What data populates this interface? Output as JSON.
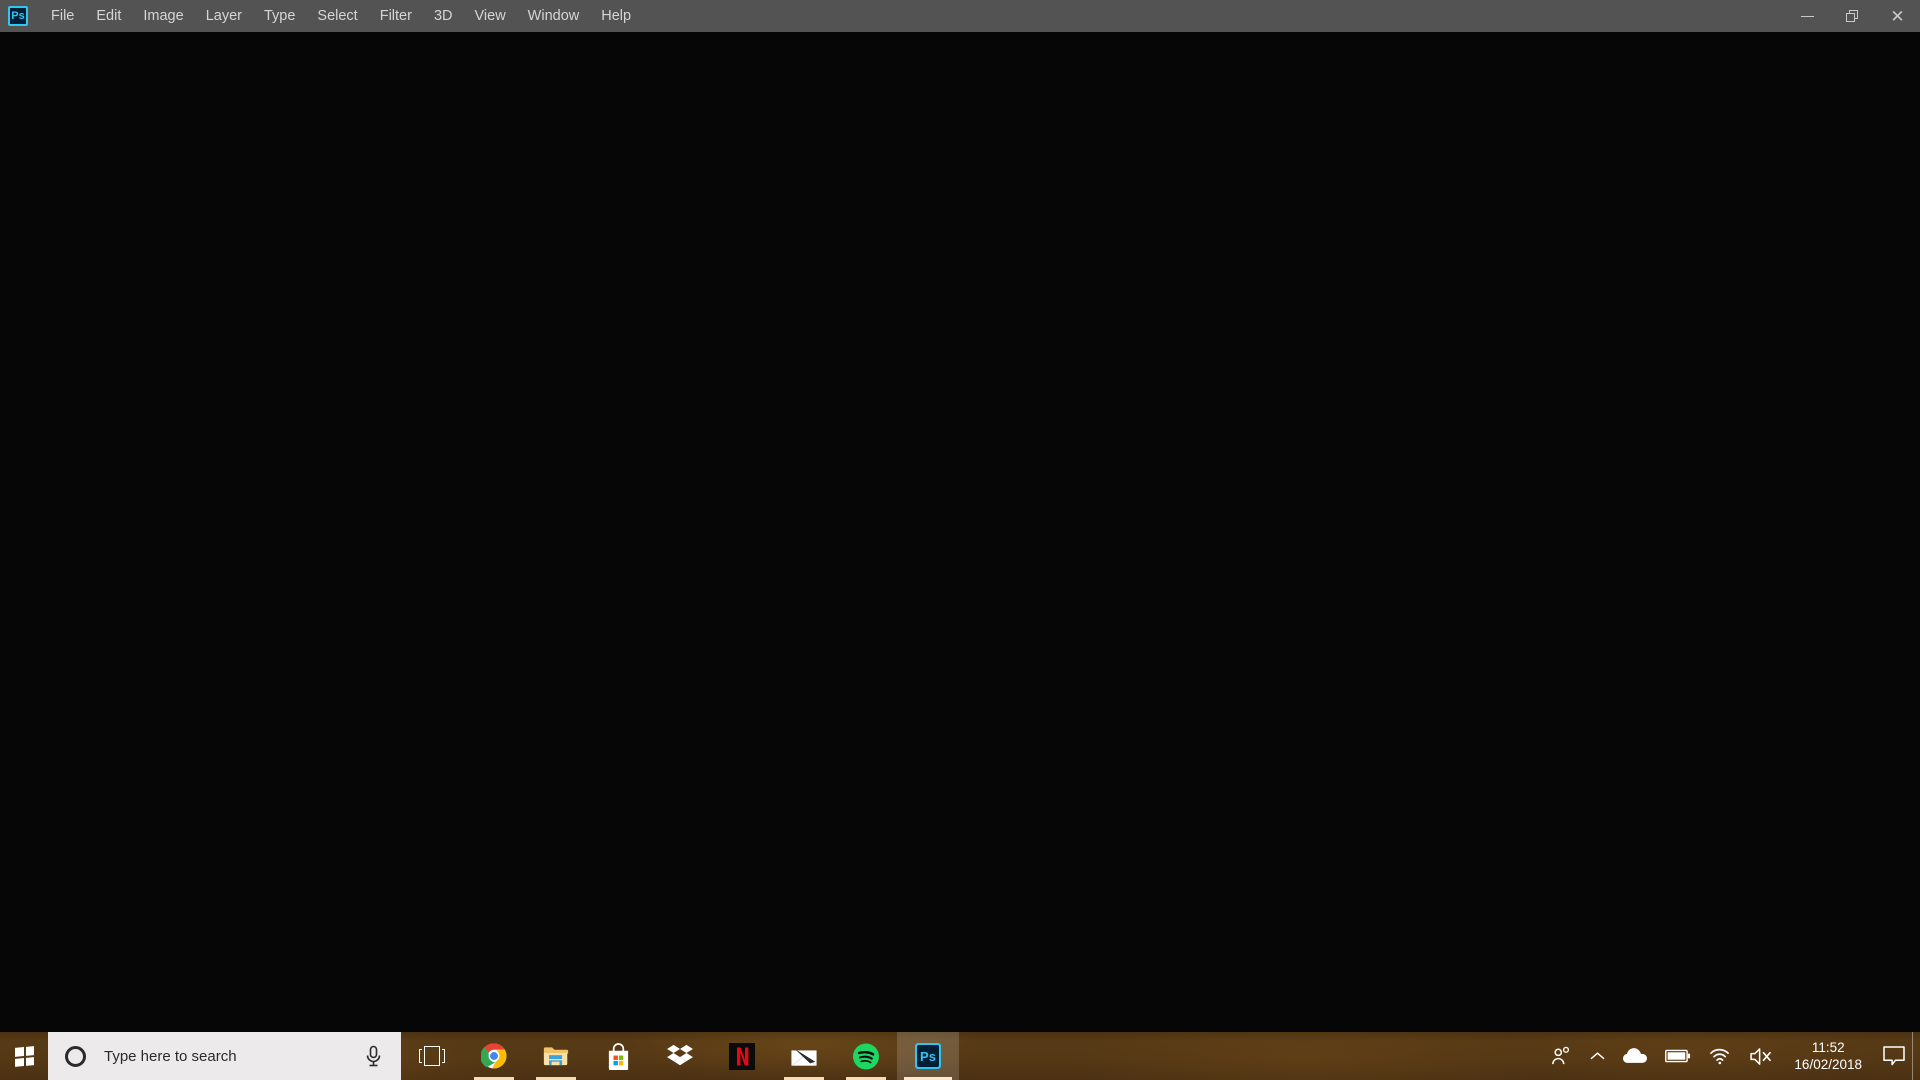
{
  "app": {
    "name": "Adobe Photoshop",
    "icon": "photoshop-icon",
    "icon_text": "Ps",
    "accent": "#31c5f0",
    "menubar_bg": "#535353",
    "canvas_bg": "#060606"
  },
  "menubar": {
    "items": [
      {
        "label": "File"
      },
      {
        "label": "Edit"
      },
      {
        "label": "Image"
      },
      {
        "label": "Layer"
      },
      {
        "label": "Type"
      },
      {
        "label": "Select"
      },
      {
        "label": "Filter"
      },
      {
        "label": "3D"
      },
      {
        "label": "View"
      },
      {
        "label": "Window"
      },
      {
        "label": "Help"
      }
    ],
    "window_controls": [
      {
        "name": "minimize",
        "glyph": "—"
      },
      {
        "name": "restore",
        "glyph": "❐"
      },
      {
        "name": "close",
        "glyph": "✕"
      }
    ]
  },
  "taskbar": {
    "background": "#533715",
    "start": {
      "label": "Start",
      "icon": "windows-logo-icon"
    },
    "search": {
      "placeholder": "Type here to search",
      "value": "",
      "cortana_icon": "cortana-circle-icon",
      "mic_icon": "microphone-icon",
      "background": "#eceaea"
    },
    "taskview": {
      "label": "Task View",
      "icon": "task-view-icon"
    },
    "apps": [
      {
        "name": "google-chrome",
        "label": "Google Chrome",
        "running": true,
        "active": false
      },
      {
        "name": "file-explorer",
        "label": "File Explorer",
        "running": true,
        "active": false
      },
      {
        "name": "microsoft-store",
        "label": "Microsoft Store",
        "running": false,
        "active": false
      },
      {
        "name": "dropbox",
        "label": "Dropbox",
        "running": false,
        "active": false
      },
      {
        "name": "netflix",
        "label": "Netflix",
        "running": false,
        "active": false
      },
      {
        "name": "mail",
        "label": "Mail",
        "running": true,
        "active": false
      },
      {
        "name": "spotify",
        "label": "Spotify",
        "running": true,
        "active": false
      },
      {
        "name": "photoshop",
        "label": "Adobe Photoshop",
        "running": true,
        "active": true,
        "icon_text": "Ps"
      }
    ],
    "tray": {
      "icons": [
        {
          "name": "people-icon",
          "label": "People"
        },
        {
          "name": "show-hidden-icons-chevron-icon",
          "label": "Show hidden icons"
        },
        {
          "name": "onedrive-cloud-icon",
          "label": "OneDrive"
        },
        {
          "name": "battery-icon",
          "label": "Battery"
        },
        {
          "name": "wifi-icon",
          "label": "Network"
        },
        {
          "name": "speaker-muted-icon",
          "label": "Volume muted"
        }
      ],
      "clock": {
        "time": "11:52",
        "date": "16/02/2018"
      },
      "action_center": {
        "name": "action-center-icon",
        "label": "Action Center"
      },
      "show_desktop": {
        "label": "Show desktop"
      }
    }
  }
}
